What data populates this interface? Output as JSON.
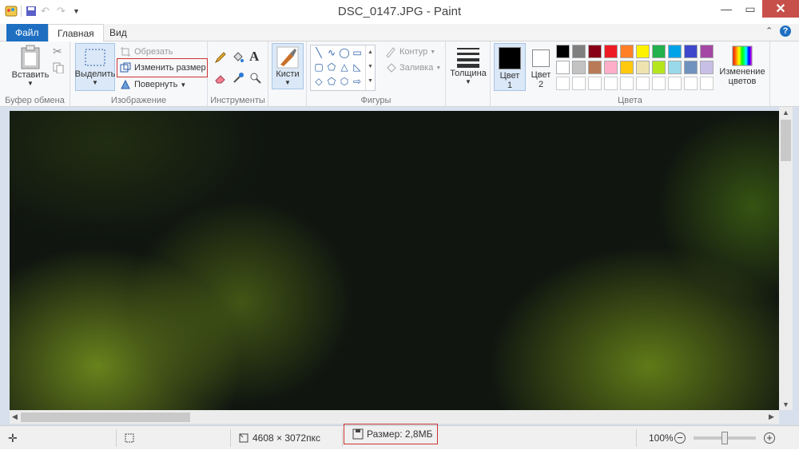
{
  "window": {
    "title": "DSC_0147.JPG - Paint"
  },
  "tabs": [
    {
      "label": "Файл"
    },
    {
      "label": "Главная"
    },
    {
      "label": "Вид"
    }
  ],
  "ribbon": {
    "clipboard": {
      "label": "Буфер обмена",
      "paste": "Вставить"
    },
    "image": {
      "label": "Изображение",
      "select": "Выделить",
      "crop": "Обрезать",
      "resize": "Изменить размер",
      "rotate": "Повернуть"
    },
    "tools": {
      "label": "Инструменты"
    },
    "brushes": {
      "label": "Кисти"
    },
    "shapes": {
      "label": "Фигуры",
      "outline": "Контур",
      "fill": "Заливка"
    },
    "size": {
      "label": "Толщина"
    },
    "colors": {
      "label": "Цвета",
      "color1": "Цвет\n1",
      "color1_line1": "Цвет",
      "color1_line2": "1",
      "color2_line1": "Цвет",
      "color2_line2": "2",
      "edit": "Изменение цветов",
      "edit_line1": "Изменение",
      "edit_line2": "цветов",
      "palette_row1": [
        "#000000",
        "#7f7f7f",
        "#880015",
        "#ed1c24",
        "#ff7f27",
        "#fff200",
        "#22b14c",
        "#00a2e8",
        "#3f48cc",
        "#a349a4"
      ],
      "palette_row2": [
        "#ffffff",
        "#c3c3c3",
        "#b97a57",
        "#ffaec9",
        "#ffc90e",
        "#efe4b0",
        "#b5e61d",
        "#99d9ea",
        "#7092be",
        "#c8bfe7"
      ]
    }
  },
  "status": {
    "dimensions": "4608 × 3072пкс",
    "filesize": "Размер: 2,8МБ",
    "zoom": "100%",
    "zoom_level": 0.5
  },
  "colors": {
    "accent": "#1e6fc1",
    "close": "#c7504a",
    "highlight": "#cc3333"
  }
}
